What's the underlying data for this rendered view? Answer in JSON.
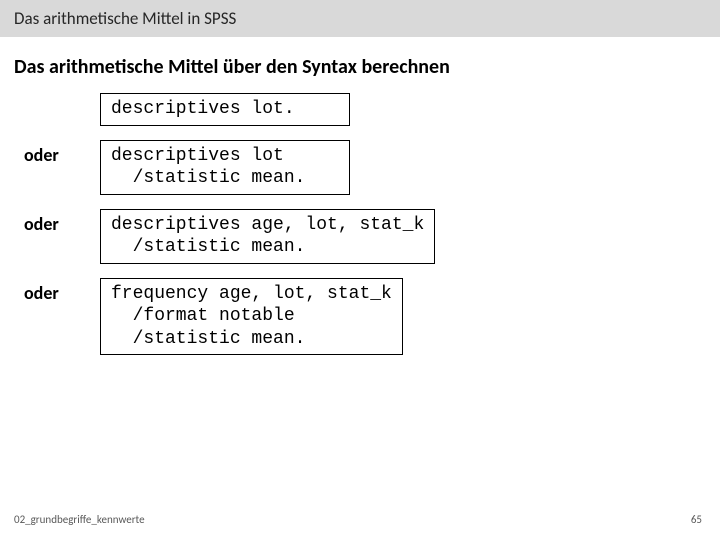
{
  "header": {
    "title": "Das arithmetische Mittel in SPSS"
  },
  "subtitle": "Das arithmetische Mittel über den Syntax berechnen",
  "rows": [
    {
      "label": "",
      "code": "descriptives lot."
    },
    {
      "label": "oder",
      "code": "descriptives lot\n  /statistic mean."
    },
    {
      "label": "oder",
      "code": "descriptives age, lot, stat_k\n  /statistic mean."
    },
    {
      "label": "oder",
      "code": "frequency age, lot, stat_k\n  /format notable\n  /statistic mean."
    }
  ],
  "footer": {
    "left": "02_grundbegriffe_kennwerte",
    "right": "65"
  }
}
